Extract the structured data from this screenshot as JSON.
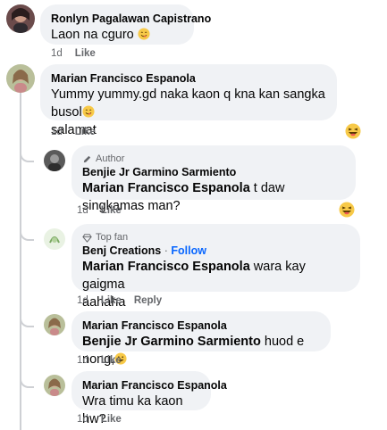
{
  "comments": [
    {
      "name": "Ronlyn Pagalawan Capistrano",
      "text": "Laon na cguro",
      "time": "1d",
      "like": "Like"
    },
    {
      "name": "Marian Francisco Espanola",
      "text_line1": "Yummy yummy.gd naka kaon q kna kan sangka busol",
      "text_line2": "salamat",
      "time": "1d",
      "like": "Like"
    }
  ],
  "replies": [
    {
      "badge": "Author",
      "name": "Benjie Jr Garmino Sarmiento",
      "mention": "Marian Francisco Espanola",
      "text": "t daw singkamas man?",
      "time": "1d",
      "like": "Like"
    },
    {
      "badge": "Top fan",
      "name": "Benj Creations",
      "separator": "·",
      "follow": "Follow",
      "mention": "Marian Francisco Espanola",
      "text_line1": "wara kay gaigma",
      "text_line2": "aahaha",
      "time": "1d",
      "like": "Like",
      "reply": "Reply"
    },
    {
      "name": "Marian Francisco Espanola",
      "mention": "Benjie Jr Garmino Sarmiento",
      "text": "huod e nong,",
      "time": "1d",
      "like": "Like"
    },
    {
      "name": "Marian Francisco Espanola",
      "text": "Wra timu ka kaon hw?",
      "time": "1d",
      "like": "Like"
    }
  ],
  "colors": {
    "bubble": "#f0f2f5",
    "meta": "#65676b",
    "follow": "#0866ff",
    "line": "#ced0d4"
  }
}
